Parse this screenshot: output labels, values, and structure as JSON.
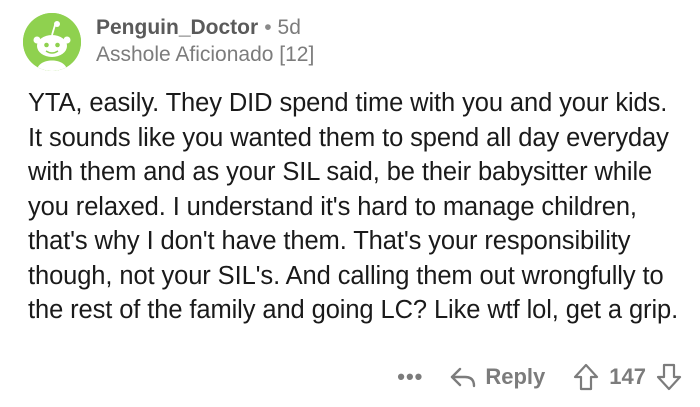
{
  "comment": {
    "author": "Penguin_Doctor",
    "separator": "•",
    "age": "5d",
    "flair": "Asshole Aficionado [12]",
    "body": "YTA, easily. They DID spend time with you and your kids. It sounds like you wanted them to spend all day everyday with them and as your SIL said, be their babysitter while you relaxed. I understand it's hard to manage children, that's why I don't have them. That's your responsibility though, not your SIL's. And calling them out wrongfully to the rest of the family and going LC? Like wtf lol, get a grip.",
    "avatar_color": "#8fd14f"
  },
  "actions": {
    "more_label": "•••",
    "reply_label": "Reply",
    "vote_count": "147",
    "icons": [
      "more-icon",
      "reply-arrow-icon",
      "upvote-icon",
      "downvote-icon"
    ]
  }
}
